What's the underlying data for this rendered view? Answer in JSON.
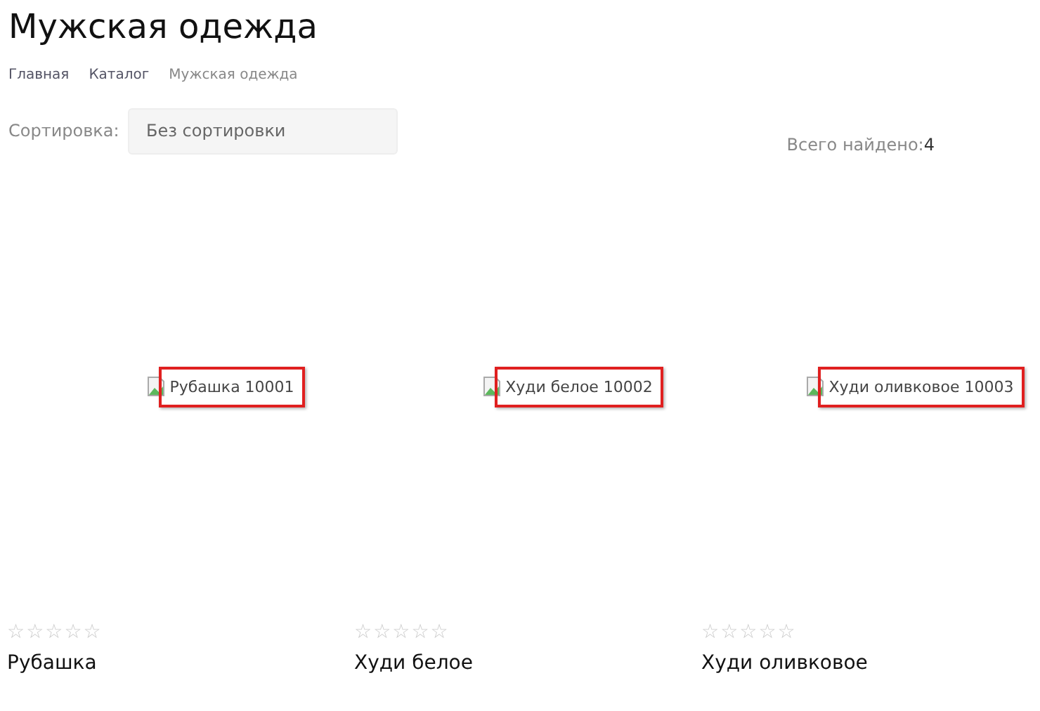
{
  "title": "Мужская одежда",
  "breadcrumbs": [
    {
      "label": "Главная",
      "current": false
    },
    {
      "label": "Каталог",
      "current": false
    },
    {
      "label": "Мужская одежда",
      "current": true
    }
  ],
  "sort": {
    "label": "Сортировка:",
    "value": "Без сортировки"
  },
  "found": {
    "label": "Всего найдено:",
    "count": "4"
  },
  "products": [
    {
      "image_alt": "Рубашка 10001",
      "stars": 0,
      "name": "Рубашка"
    },
    {
      "image_alt": "Худи белое 10002",
      "stars": 0,
      "name": "Худи белое"
    },
    {
      "image_alt": "Худи оливковое 10003",
      "stars": 0,
      "name": "Худи оливковое"
    }
  ]
}
